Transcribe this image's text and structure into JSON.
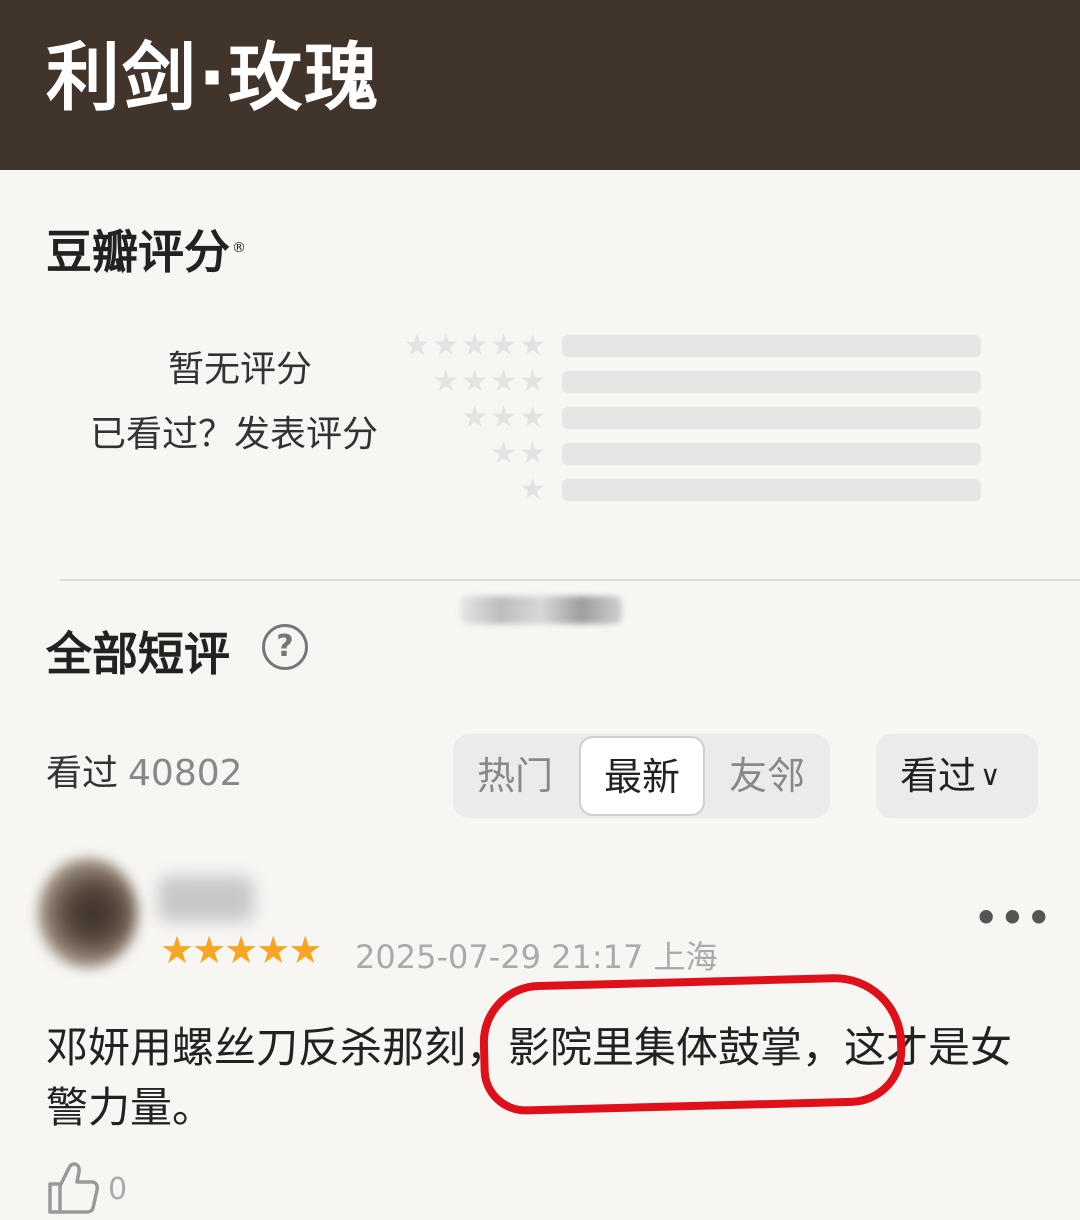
{
  "header": {
    "title": "利剑·玫瑰"
  },
  "rating": {
    "title": "豆瓣评分",
    "reg_mark": "®",
    "no_rating": "暂无评分",
    "rate_prompt": "已看过？发表评分",
    "star_rows": [
      5,
      4,
      3,
      2,
      1
    ]
  },
  "reviews": {
    "title": "全部短评",
    "help_icon": "?",
    "seen_label": "看过",
    "seen_count": "40802",
    "tabs": [
      {
        "label": "热门",
        "active": false
      },
      {
        "label": "最新",
        "active": true
      },
      {
        "label": "友邻",
        "active": false
      }
    ],
    "filter_label": "看过",
    "filter_chevron": "∨"
  },
  "comment": {
    "stars": "★★★★★",
    "rating": 5,
    "date": "2025-07-29 21:17",
    "location": "上海",
    "more": "•••",
    "text": "邓妍用螺丝刀反杀那刻，影院里集体鼓掌，这才是女警力量。",
    "likes": "0"
  },
  "colors": {
    "header_bg": "#41342a",
    "accent_star": "#f5a623",
    "annotation": "#e0101a"
  }
}
